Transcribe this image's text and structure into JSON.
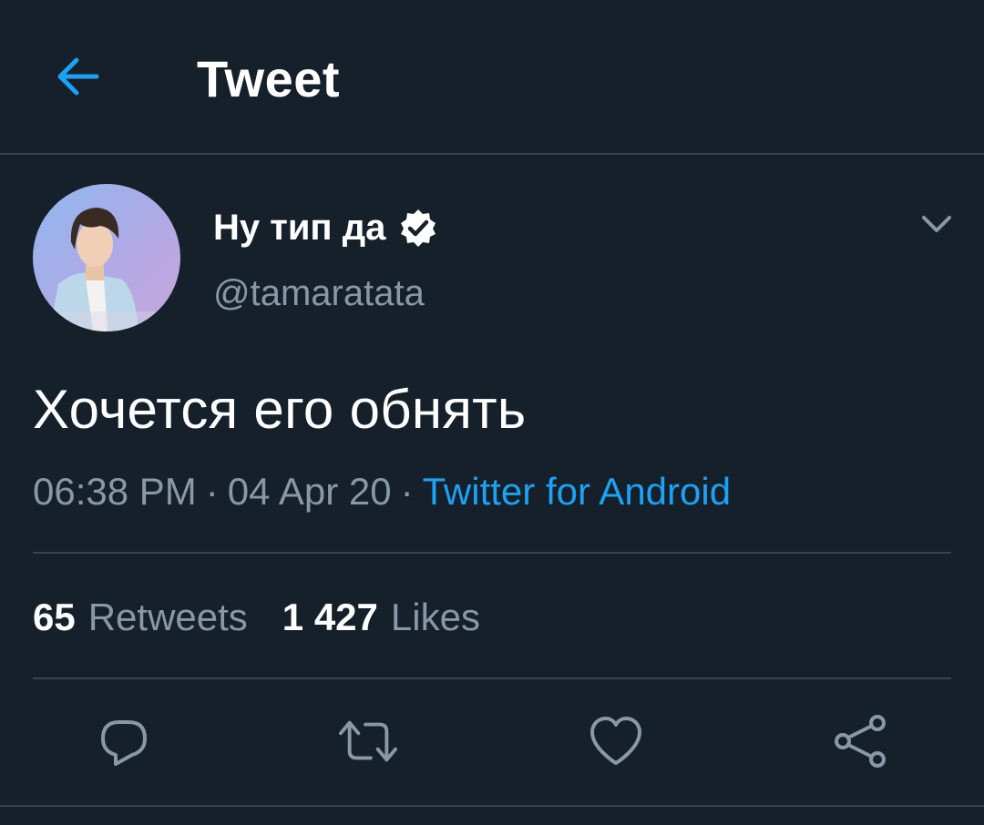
{
  "header": {
    "back_icon": "arrow-left-icon",
    "title": "Tweet"
  },
  "colors": {
    "background": "#15202b",
    "accent": "#1da1f2",
    "secondary_text": "#8899a6",
    "divider": "#38444d"
  },
  "author": {
    "display_name": "Ну тип да",
    "handle": "@tamaratata",
    "verified": true,
    "verified_icon": "verified-badge-icon",
    "menu_icon": "chevron-down-icon"
  },
  "tweet": {
    "text": "Хочется его обнять",
    "time": "06:38 PM",
    "date": "04 Apr 20",
    "separator": "·",
    "source": "Twitter for Android"
  },
  "stats": {
    "retweets_count": "65",
    "retweets_label": "Retweets",
    "likes_count": "1 427",
    "likes_label": "Likes"
  },
  "actions": [
    {
      "icon": "reply-icon"
    },
    {
      "icon": "retweet-icon"
    },
    {
      "icon": "like-heart-icon"
    },
    {
      "icon": "share-icon"
    }
  ]
}
